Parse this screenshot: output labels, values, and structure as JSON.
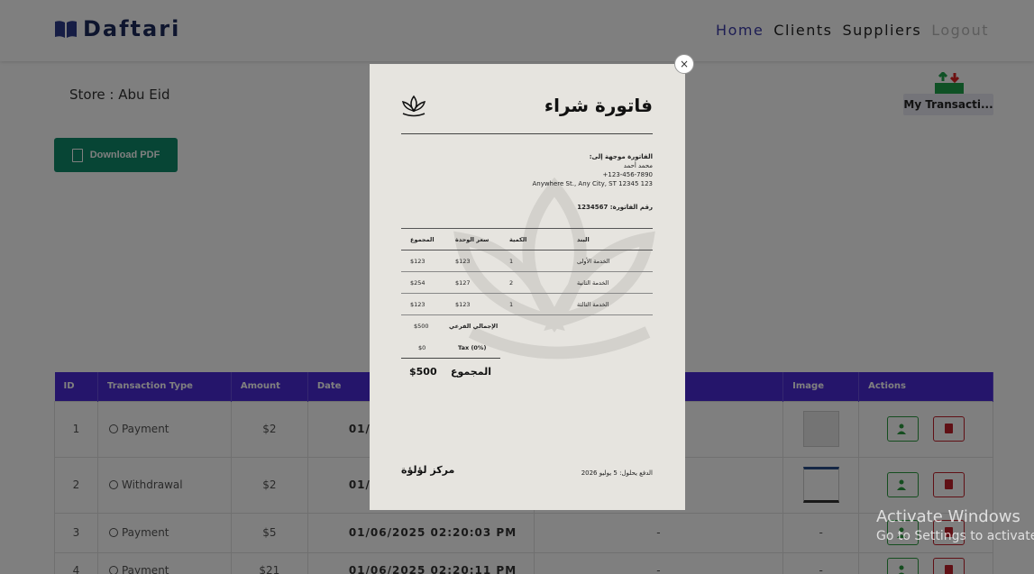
{
  "nav": {
    "brand": "Daftari",
    "links": {
      "home": "Home",
      "clients": "Clients",
      "suppliers": "Suppliers",
      "logout": "Logout"
    }
  },
  "store": {
    "label": "Store : Abu Eid"
  },
  "buttons": {
    "download_pdf": "Download PDF",
    "my_transactions": "My Transacti..."
  },
  "table": {
    "headers": {
      "id": "ID",
      "type": "Transaction Type",
      "amount": "Amount",
      "date": "Date",
      "image": "Image",
      "actions": "Actions"
    },
    "rows": [
      {
        "id": "1",
        "type": "Payment",
        "amount": "$2",
        "date": "01/0",
        "note": "",
        "image": "thumb"
      },
      {
        "id": "2",
        "type": "Withdrawal",
        "amount": "$2",
        "date": "01/0",
        "note": "",
        "image": "thumb"
      },
      {
        "id": "3",
        "type": "Payment",
        "amount": "$5",
        "date": "01/06/2025 02:20:03 PM",
        "note": "-",
        "image": "-"
      },
      {
        "id": "4",
        "type": "Payment",
        "amount": "$21",
        "date": "01/06/2025 02:20:11 PM",
        "note": "-",
        "image": "-"
      }
    ]
  },
  "modal": {
    "close": "×",
    "invoice": {
      "title": "فاتورة شراء",
      "bill_to_heading": "الفاتورة موجهة إلى:",
      "bill_to_name": "محمد أحمد",
      "bill_to_phone": "123-456-7890+",
      "bill_to_address": "Anywhere St., Any City, ST 12345 123",
      "invoice_number": "رقم الفاتورة: 1234567",
      "columns": {
        "item": "البند",
        "qty": "الكمية",
        "unit_price": "سعر الوحدة",
        "total": "المجموع"
      },
      "items": [
        {
          "item": "الخدمة الأولى",
          "qty": "1",
          "unit_price": "$123",
          "total": "$123"
        },
        {
          "item": "الخدمة الثانية",
          "qty": "2",
          "unit_price": "$127",
          "total": "$254"
        },
        {
          "item": "الخدمة الثالثة",
          "qty": "1",
          "unit_price": "$123",
          "total": "$123"
        }
      ],
      "subtotal_label": "الإجمالي الفرعي",
      "subtotal_value": "$500",
      "tax_label": "Tax (0%)",
      "tax_value": "$0",
      "grand_label": "المجموع",
      "grand_value": "$500",
      "signature": "مركز لؤلؤة",
      "due": "الدفع يحلول: 5 يوليو 2026"
    }
  },
  "watermark": {
    "title": "Activate Windows",
    "sub": "Go to Settings to activate W"
  },
  "colors": {
    "accent": "#4b2bd6",
    "download": "#0f8a6a",
    "payment": "#2b9a3f",
    "withdrawal": "#c0202a"
  }
}
